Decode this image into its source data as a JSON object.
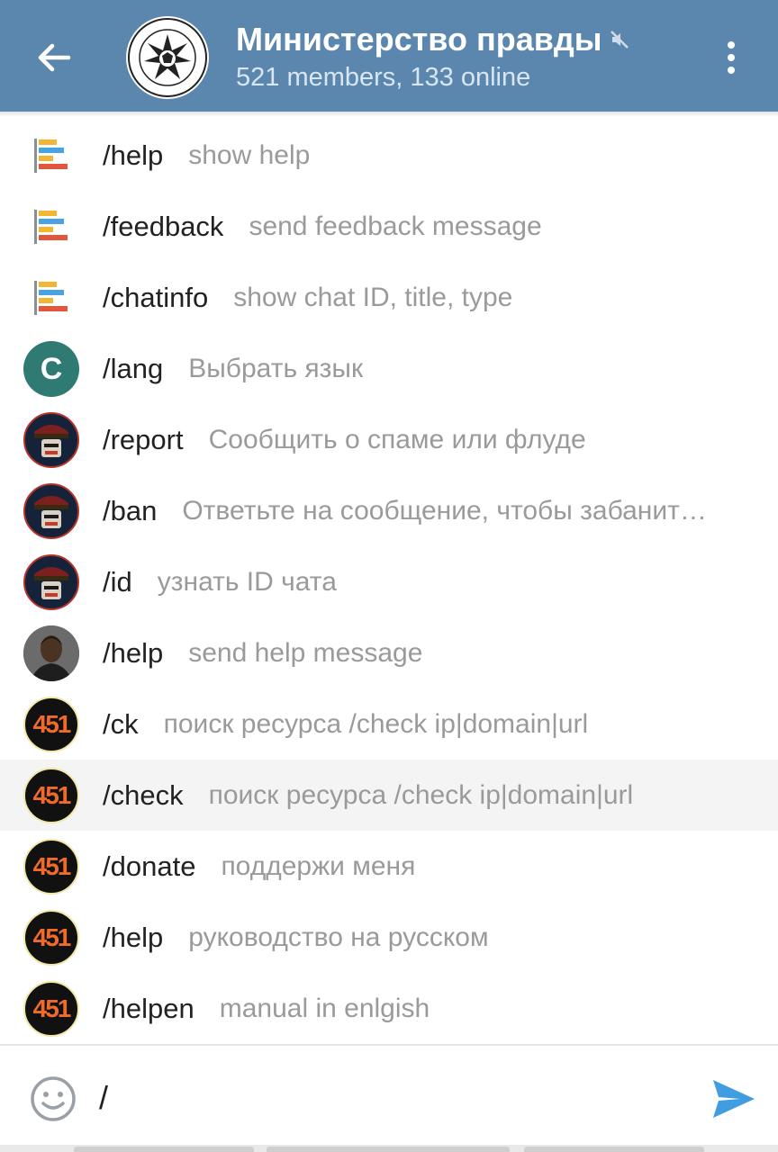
{
  "header": {
    "title": "Министерство правды",
    "subtitle": "521 members, 133 online",
    "colors": {
      "bar": "#5b87af",
      "subtitle": "#d9e6f2"
    }
  },
  "commands": [
    {
      "command": "/help",
      "description": "show help",
      "avatar": "bars-icon"
    },
    {
      "command": "/feedback",
      "description": "send feedback message",
      "avatar": "bars-icon"
    },
    {
      "command": "/chatinfo",
      "description": "show chat ID, title, type",
      "avatar": "bars-icon"
    },
    {
      "command": "/lang",
      "description": "Выбрать язык",
      "avatar": "letter-c",
      "letter": "C"
    },
    {
      "command": "/report",
      "description": "Сообщить о спаме или флуде",
      "avatar": "robot-officer"
    },
    {
      "command": "/ban",
      "description": "Ответьте на сообщение, чтобы забанит…",
      "avatar": "robot-officer"
    },
    {
      "command": "/id",
      "description": "узнать ID чата",
      "avatar": "robot-officer"
    },
    {
      "command": "/help",
      "description": "send help message",
      "avatar": "person-photo"
    },
    {
      "command": "/ck",
      "description": "поиск ресурса /check ip|domain|url",
      "avatar": "badge-451",
      "badge": "451"
    },
    {
      "command": "/check",
      "description": "поиск ресурса /check ip|domain|url",
      "avatar": "badge-451",
      "badge": "451"
    },
    {
      "command": "/donate",
      "description": "поддержи меня",
      "avatar": "badge-451",
      "badge": "451"
    },
    {
      "command": "/help",
      "description": "руководство на русском",
      "avatar": "badge-451",
      "badge": "451"
    },
    {
      "command": "/helpen",
      "description": "manual in enlgish",
      "avatar": "badge-451",
      "badge": "451"
    }
  ],
  "input": {
    "value": "/"
  },
  "colors": {
    "accent": "#3f9de0",
    "command": "#222222",
    "description": "#9a9a9a",
    "highlight": "#f4f4f4"
  }
}
